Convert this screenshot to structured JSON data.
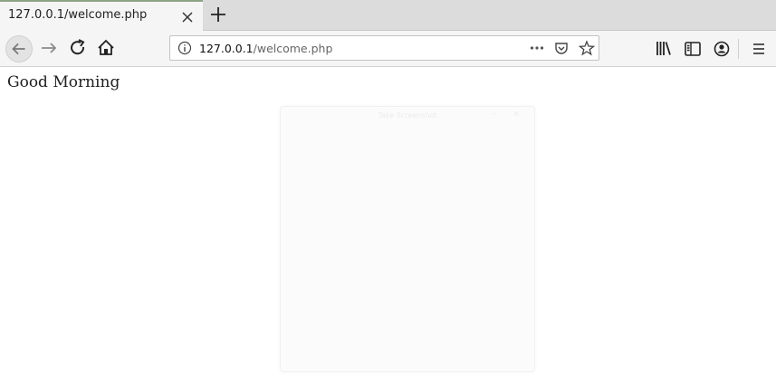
{
  "browser": {
    "tab": {
      "title": "127.0.0.1/welcome.php"
    },
    "url": {
      "host": "127.0.0.1",
      "path": "/welcome.php"
    }
  },
  "page": {
    "greeting": "Good Morning",
    "overlay_window": {
      "title": "Take Screenshot",
      "controls": "– ×"
    }
  }
}
